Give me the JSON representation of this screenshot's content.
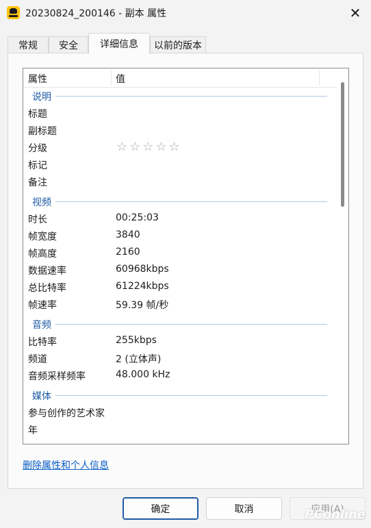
{
  "window": {
    "title": "20230824_200146 - 副本 属性",
    "close_glyph": "✕"
  },
  "tabs": [
    {
      "label": "常规"
    },
    {
      "label": "安全"
    },
    {
      "label": "详细信息"
    },
    {
      "label": "以前的版本"
    }
  ],
  "details": {
    "col_property": "属性",
    "col_value": "值",
    "groups": {
      "description": "说明",
      "video": "视频",
      "audio": "音频",
      "media": "媒体"
    },
    "rows": {
      "title": {
        "k": "标题",
        "v": ""
      },
      "subtitle": {
        "k": "副标题",
        "v": ""
      },
      "rating": {
        "k": "分级",
        "v": "☆☆☆☆☆"
      },
      "tags": {
        "k": "标记",
        "v": ""
      },
      "comments": {
        "k": "备注",
        "v": ""
      },
      "duration": {
        "k": "时长",
        "v": "00:25:03"
      },
      "frame_width": {
        "k": "帧宽度",
        "v": "3840"
      },
      "frame_height": {
        "k": "帧高度",
        "v": "2160"
      },
      "data_rate": {
        "k": "数据速率",
        "v": "60968kbps"
      },
      "total_bitrate": {
        "k": "总比特率",
        "v": "61224kbps"
      },
      "frame_rate": {
        "k": "帧速率",
        "v": "59.39 帧/秒"
      },
      "bitrate": {
        "k": "比特率",
        "v": "255kbps"
      },
      "channels": {
        "k": "频道",
        "v": "2 (立体声)"
      },
      "sample_rate": {
        "k": "音频采样频率",
        "v": "48.000 kHz"
      },
      "contributing_artists": {
        "k": "参与创作的艺术家",
        "v": ""
      },
      "year": {
        "k": "年",
        "v": ""
      }
    },
    "rating_stars": 0
  },
  "remove_link": "删除属性和个人信息",
  "buttons": {
    "ok": "确定",
    "cancel": "取消",
    "apply": "应用(A)"
  },
  "watermark": "PConline"
}
